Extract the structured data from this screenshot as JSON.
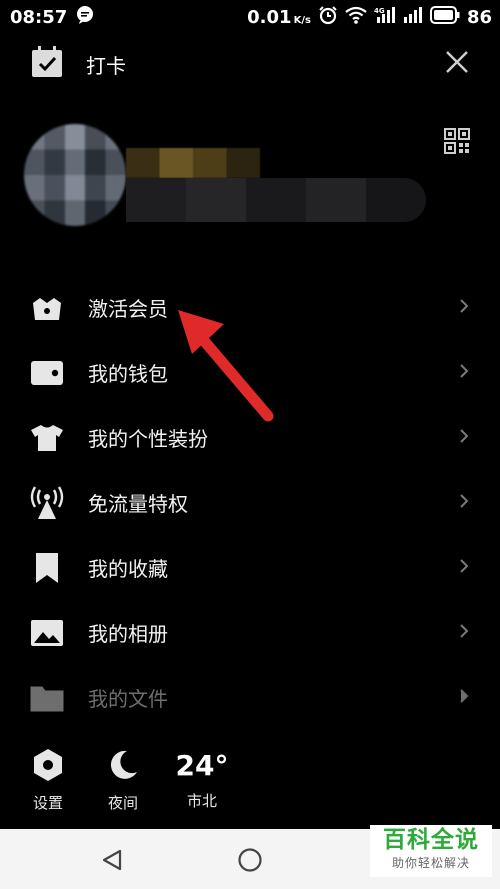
{
  "status_bar": {
    "time": "08:57",
    "net_speed": "0.01",
    "net_speed_unit": "K/s",
    "battery": "86"
  },
  "header": {
    "checkin_label": "打卡"
  },
  "menu": {
    "items": [
      {
        "label": "激活会员",
        "icon": "crown-basket-icon"
      },
      {
        "label": "我的钱包",
        "icon": "wallet-icon"
      },
      {
        "label": "我的个性装扮",
        "icon": "tshirt-icon"
      },
      {
        "label": "免流量特权",
        "icon": "signal-tower-icon"
      },
      {
        "label": "我的收藏",
        "icon": "bookmark-icon"
      },
      {
        "label": "我的相册",
        "icon": "photo-icon"
      },
      {
        "label": "我的文件",
        "icon": "folder-icon"
      }
    ]
  },
  "bottom_bar": {
    "settings_label": "设置",
    "night_label": "夜间",
    "temperature": "24°",
    "city": "市北"
  },
  "watermark": {
    "title": "百科全说",
    "subtitle": "助你轻松解决"
  }
}
